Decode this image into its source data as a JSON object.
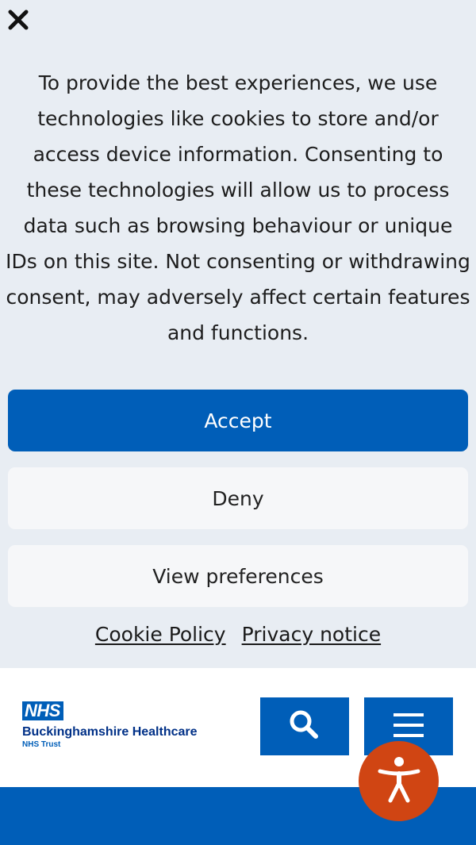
{
  "consent": {
    "message": "To provide the best experiences, we use technologies like cookies to store and/or access device information. Consenting to these technologies will allow us to process data such as browsing behaviour or unique IDs on this site. Not consenting or withdrawing consent, may adversely affect certain features and functions.",
    "close_icon": "close-icon",
    "accept_label": "Accept",
    "deny_label": "Deny",
    "preferences_label": "View preferences",
    "cookie_policy_link": "Cookie Policy",
    "privacy_notice_link": "Privacy notice"
  },
  "header": {
    "logo": {
      "badge": "NHS",
      "org_name": "Buckinghamshire Healthcare",
      "org_sub": "NHS Trust"
    },
    "search_icon": "search-icon",
    "menu_icon": "hamburger-menu-icon"
  },
  "accessibility": {
    "icon": "accessibility-person-icon"
  },
  "colors": {
    "nhs_blue": "#005eb8",
    "consent_bg": "#e8edf3",
    "accessibility_orange": "#d04513",
    "nhs_dark_blue": "#003087"
  }
}
